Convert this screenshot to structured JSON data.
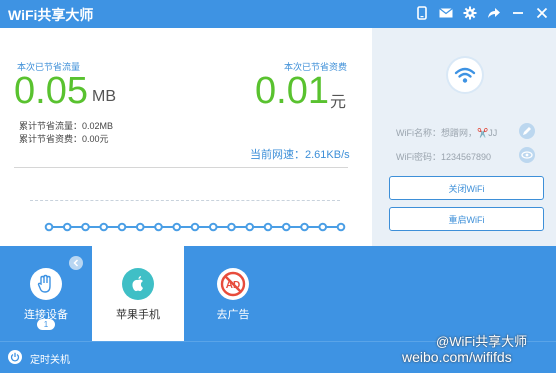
{
  "window": {
    "title": "WiFi共享大师",
    "icons": [
      "phone-icon",
      "mail-icon",
      "settings-icon",
      "share-icon",
      "minimize-icon",
      "close-icon"
    ]
  },
  "stats": {
    "saved_traffic_label": "本次已节省流量",
    "saved_traffic_value": "0.05",
    "saved_traffic_unit": "MB",
    "saved_cost_label": "本次已节省资费",
    "saved_cost_value": "0.01",
    "saved_cost_unit": "元",
    "total_traffic_text": "累计节省流量：0.02MB",
    "total_cost_text": "累计节省资费：0.00元",
    "speed_label": "当前网速：",
    "speed_value": "2.61KB/s"
  },
  "side": {
    "wifi_name_label": "WiFi名称：",
    "wifi_name_value": "想蹭网，✂️JJ",
    "wifi_password_label": "WiFi密码：",
    "wifi_password_value": "1234567890",
    "close_button": "关闭WiFi",
    "restart_button": "重启WiFi"
  },
  "tabs": [
    {
      "label": "连接设备",
      "badge": "1"
    },
    {
      "label": "苹果手机"
    },
    {
      "label": "去广告"
    }
  ],
  "footer": {
    "label": "定时关机"
  },
  "watermark": {
    "weibo": "@WiFi共享大师",
    "url": "weibo.com/wififds"
  },
  "chart_data": {
    "type": "line",
    "points": 17,
    "values": [
      0,
      0,
      0,
      0,
      0,
      0,
      0,
      0,
      0,
      0,
      0,
      0,
      0,
      0,
      0,
      0,
      0
    ]
  },
  "colors": {
    "accent": "#3e93e3",
    "green": "#59c22f",
    "text_blue": "#3d8fd8"
  }
}
